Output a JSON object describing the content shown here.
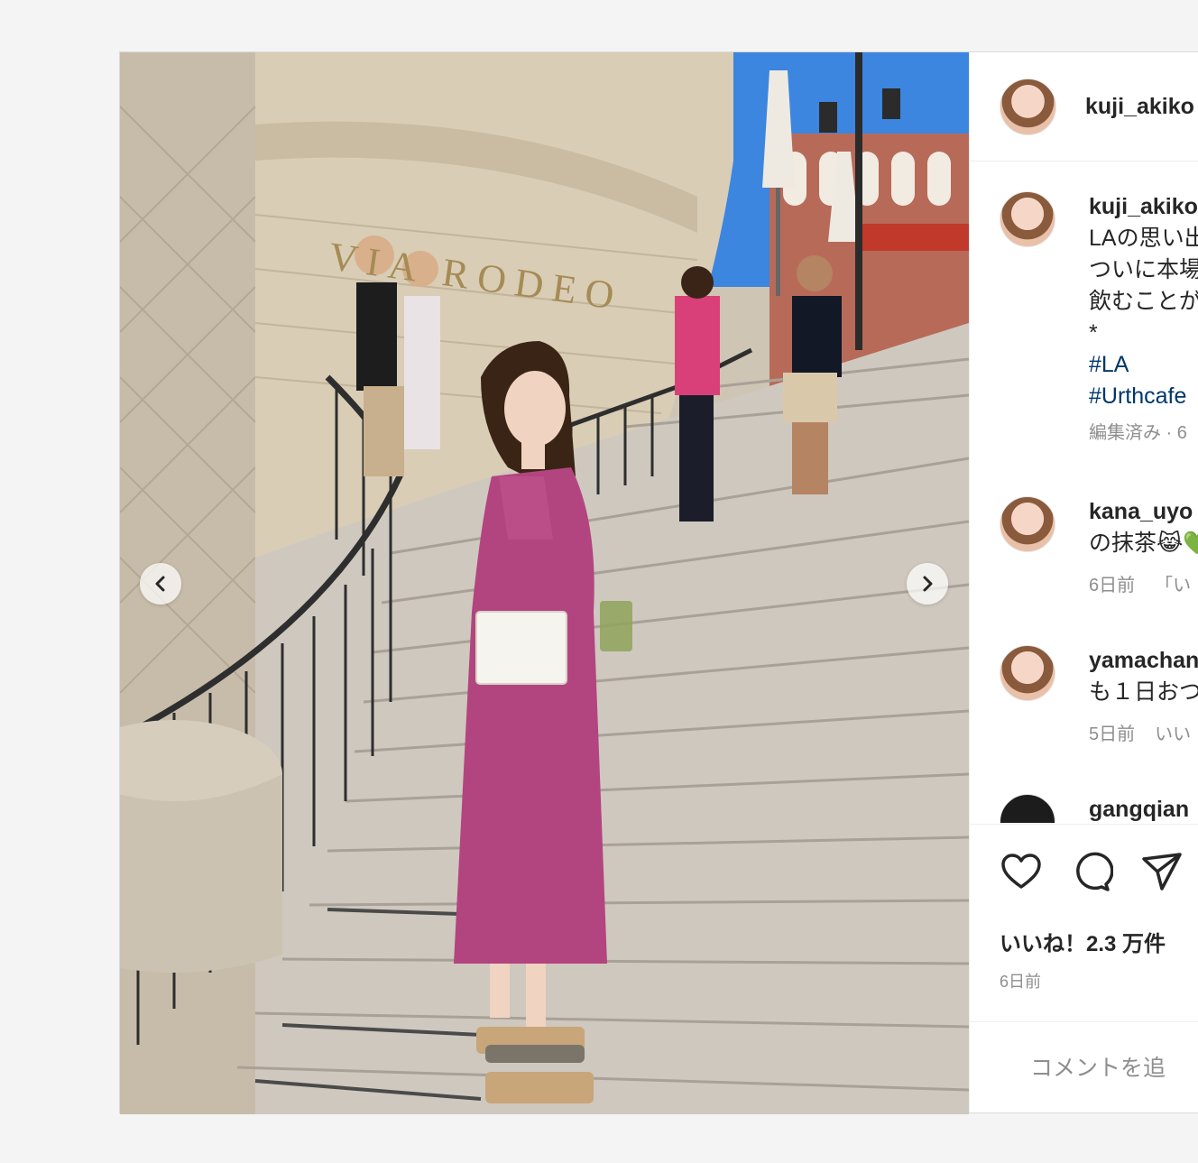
{
  "post": {
    "author": "kuji_akiko",
    "photo_sign_text": "VIA RODEO",
    "caption_lines": [
      "LAの思い出",
      "ついに本場",
      "飲むことが"
    ],
    "caption_bullet": "*",
    "hashtags": [
      "#LA",
      "#Urthcafe"
    ],
    "edited_meta": "編集済み · 6"
  },
  "comments": [
    {
      "user": "kana_uyo",
      "text": "の抹茶😹💚",
      "time": "6日前",
      "extra": "「い"
    },
    {
      "user": "yamachan",
      "text": "も１日おつ",
      "time": "5日前",
      "extra": "いい"
    },
    {
      "user": "gangqian",
      "text": "",
      "time": "",
      "extra": ""
    }
  ],
  "likes_text": "いいね！2.3 万件",
  "post_date": "6日前",
  "comment_input": {
    "placeholder": "コメントを追"
  },
  "icons": {
    "prev": "chevron-left-icon",
    "next": "chevron-right-icon",
    "like": "heart-icon",
    "comment": "speech-bubble-icon",
    "share": "paper-plane-icon",
    "emoji": "smiley-icon"
  },
  "colors": {
    "link": "#00376b",
    "meta": "#8e8e8e",
    "dress": "#b2457f"
  }
}
